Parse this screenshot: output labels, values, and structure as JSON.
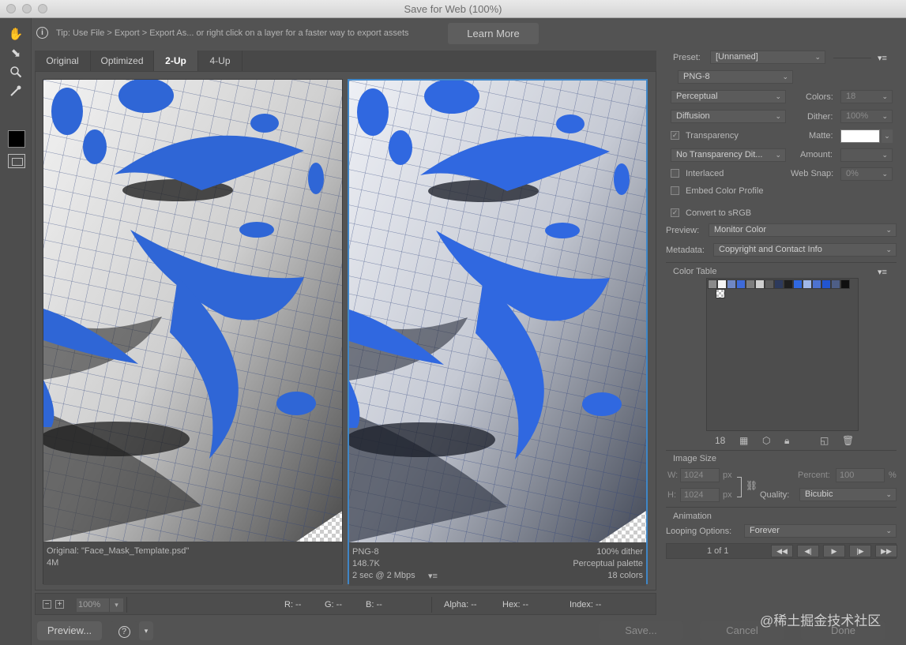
{
  "window": {
    "title": "Save for Web (100%)"
  },
  "tip": {
    "text": "Tip: Use File > Export > Export As... or right click on a layer for a faster way to export assets",
    "learn_more": "Learn More"
  },
  "tabs": [
    "Original",
    "Optimized",
    "2-Up",
    "4-Up"
  ],
  "active_tab": "2-Up",
  "left_pane": {
    "line1": "Original: \"Face_Mask_Template.psd\"",
    "line2": "4M"
  },
  "right_pane": {
    "format": "PNG-8",
    "size": "148.7K",
    "speed": "2 sec @ 2 Mbps",
    "dither": "100% dither",
    "palette": "Perceptual palette",
    "colors": "18 colors"
  },
  "status": {
    "zoom": "100%",
    "r": "R: --",
    "g": "G: --",
    "b": "B: --",
    "alpha": "Alpha: --",
    "hex": "Hex: --",
    "index": "Index: --"
  },
  "footer": {
    "preview": "Preview...",
    "help": "?",
    "save": "Save...",
    "cancel": "Cancel",
    "done": "Done"
  },
  "settings": {
    "preset_label": "Preset:",
    "preset_value": "[Unnamed]",
    "format": "PNG-8",
    "reduction": "Perceptual",
    "colors_label": "Colors:",
    "colors_value": "18",
    "dither_algo": "Diffusion",
    "dither_label": "Dither:",
    "dither_value": "100%",
    "transparency": "Transparency",
    "matte_label": "Matte:",
    "transparency_dither": "No Transparency Dit...",
    "amount_label": "Amount:",
    "interlaced": "Interlaced",
    "web_snap_label": "Web Snap:",
    "web_snap_value": "0%",
    "embed_profile": "Embed Color Profile",
    "convert_srgb": "Convert to sRGB",
    "preview_label": "Preview:",
    "preview_value": "Monitor Color",
    "metadata_label": "Metadata:",
    "metadata_value": "Copyright and Contact Info"
  },
  "color_table": {
    "title": "Color Table",
    "count": "18",
    "colors": [
      "#8a8a8a",
      "#f5f5f5",
      "#6f87c4",
      "#3e6ad8",
      "#7d7d7d",
      "#cfcfcf",
      "#5a5a5a",
      "#2d3a5c",
      "#1e1e1e",
      "#3068e0",
      "#9fb7e8",
      "#4d72cf",
      "#2255d0",
      "#4e5e86",
      "#101010"
    ]
  },
  "image_size": {
    "title": "Image Size",
    "w_label": "W:",
    "w_value": "1024",
    "h_label": "H:",
    "h_value": "1024",
    "unit": "px",
    "percent_label": "Percent:",
    "percent_value": "100",
    "percent_unit": "%",
    "quality_label": "Quality:",
    "quality_value": "Bicubic"
  },
  "animation": {
    "title": "Animation",
    "looping_label": "Looping Options:",
    "looping_value": "Forever",
    "frame": "1 of 1"
  },
  "watermark": "@稀土掘金技术社区"
}
